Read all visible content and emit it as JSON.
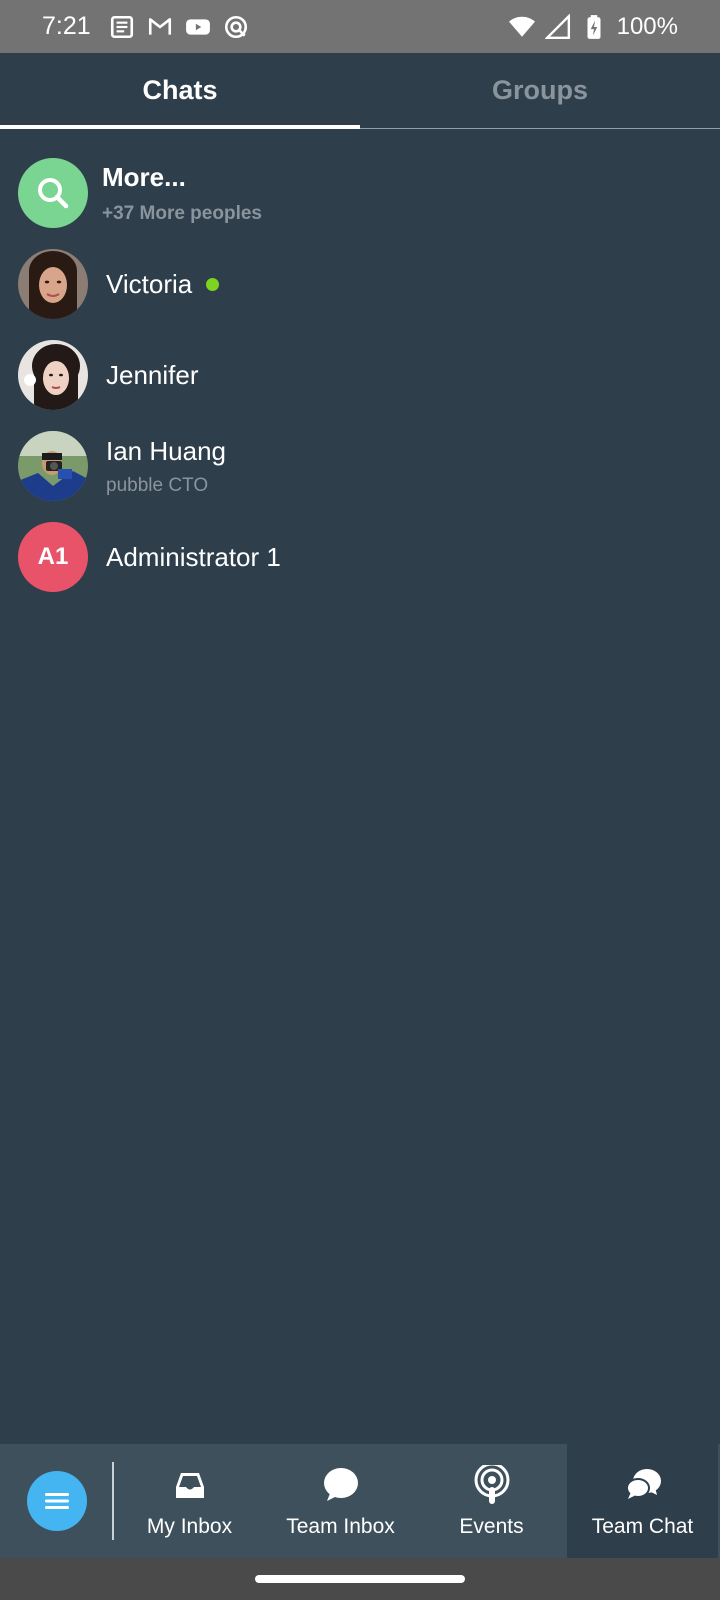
{
  "status_bar": {
    "time": "7:21",
    "battery": "100%",
    "left_icons": [
      "news-icon",
      "gmail-icon",
      "youtube-icon",
      "app-icon"
    ],
    "right_icons": [
      "wifi-icon",
      "signal-icon",
      "battery-charging-icon"
    ]
  },
  "tabs": [
    {
      "label": "Chats",
      "active": true
    },
    {
      "label": "Groups",
      "active": false
    }
  ],
  "chats": {
    "more": {
      "title": "More...",
      "subtitle": "+37 More peoples"
    },
    "items": [
      {
        "name": "Victoria",
        "online": true
      },
      {
        "name": "Jennifer"
      },
      {
        "name": "Ian Huang",
        "subtitle": "pubble CTO"
      },
      {
        "name": "Administrator 1",
        "initials": "A1"
      }
    ]
  },
  "bottom_nav": {
    "items": [
      {
        "label": "My Inbox",
        "icon": "inbox-icon"
      },
      {
        "label": "Team Inbox",
        "icon": "chat-bubble-icon"
      },
      {
        "label": "Events",
        "icon": "podcast-icon"
      },
      {
        "label": "Team Chat",
        "icon": "chat-bubbles-icon",
        "active": true
      }
    ]
  },
  "colors": {
    "background": "#2e3e4b",
    "status_bar": "#737373",
    "nav_background": "#3e505c",
    "search_avatar": "#7ad492",
    "admin_avatar": "#e9536a",
    "menu_button": "#44b5f0",
    "online": "#7ed321"
  }
}
